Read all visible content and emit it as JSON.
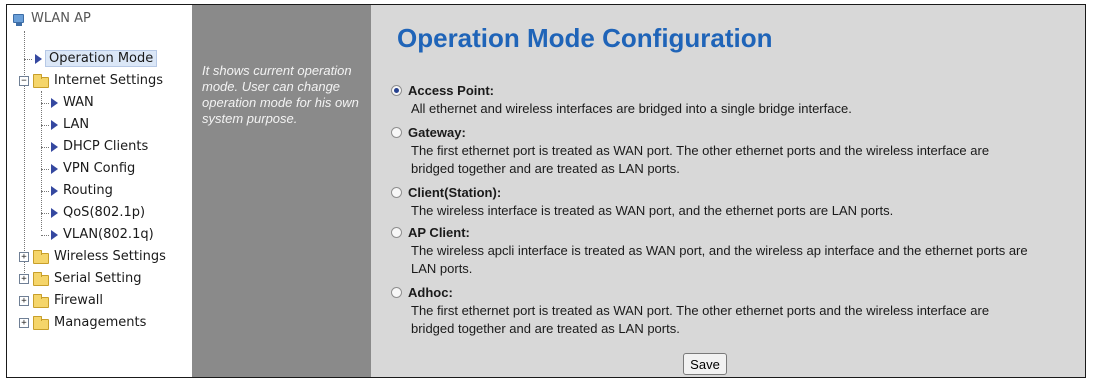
{
  "tree": {
    "root": "WLAN AP",
    "items": [
      {
        "label": "Operation Mode"
      },
      {
        "label": "Internet Settings"
      },
      {
        "label": "WAN"
      },
      {
        "label": "LAN"
      },
      {
        "label": "DHCP Clients"
      },
      {
        "label": "VPN Config"
      },
      {
        "label": "Routing"
      },
      {
        "label": "QoS(802.1p)"
      },
      {
        "label": "VLAN(802.1q)"
      },
      {
        "label": "Wireless Settings"
      },
      {
        "label": "Serial Setting"
      },
      {
        "label": "Firewall"
      },
      {
        "label": "Managements"
      }
    ]
  },
  "help": {
    "text": "It shows current operation mode. User can change operation mode for his own system purpose."
  },
  "main": {
    "title": "Operation Mode Configuration",
    "options": [
      {
        "label": "Access Point:",
        "desc": "All ethernet and wireless interfaces are bridged into a single bridge interface.",
        "selected": true
      },
      {
        "label": "Gateway:",
        "desc": "The first ethernet port is treated as WAN port. The other ethernet ports and the wireless interface are bridged together and are treated as LAN ports.",
        "selected": false
      },
      {
        "label": "Client(Station):",
        "desc": "The wireless interface is treated as WAN port, and the ethernet ports are LAN ports.",
        "selected": false
      },
      {
        "label": "AP Client:",
        "desc": "The wireless apcli interface is treated as WAN port, and the wireless ap interface and the ethernet ports are LAN ports.",
        "selected": false
      },
      {
        "label": "Adhoc:",
        "desc": "The first ethernet port is treated as WAN port. The other ethernet ports and the wireless interface are bridged together and are treated as LAN ports.",
        "selected": false
      }
    ],
    "save_label": "Save"
  }
}
